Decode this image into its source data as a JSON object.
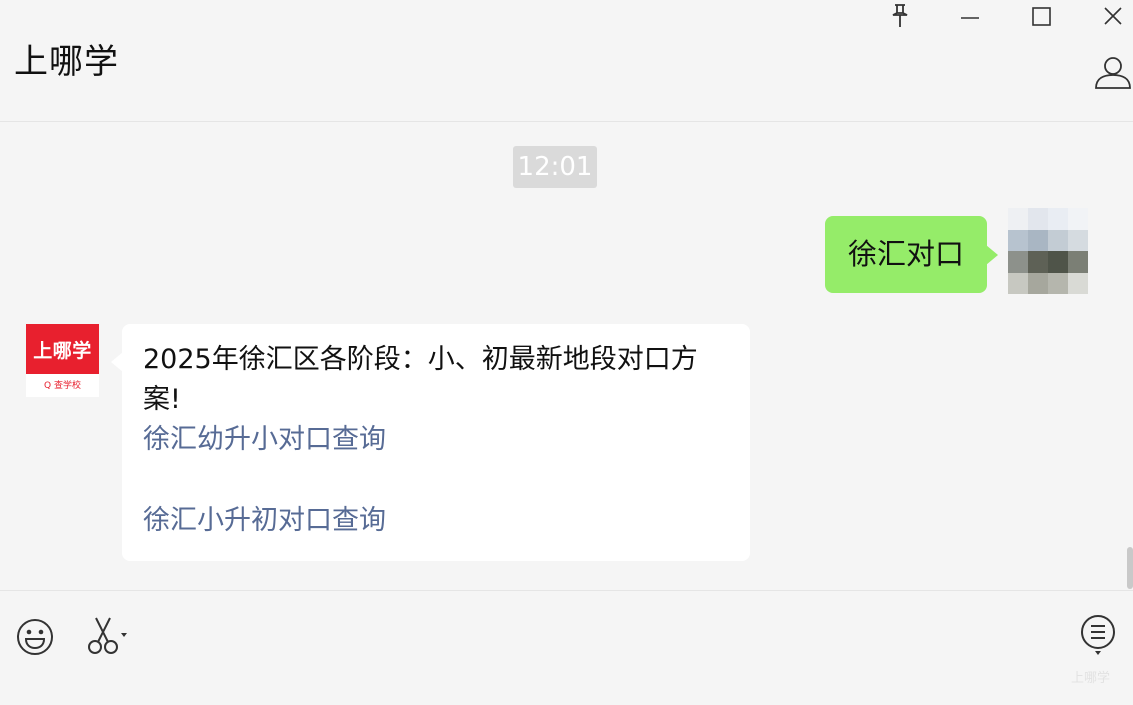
{
  "header": {
    "title": "上哪学"
  },
  "icons": {
    "pin": "pin-icon",
    "minimize": "minimize-icon",
    "maximize": "maximize-icon",
    "close": "close-icon",
    "user": "user-icon",
    "emoji": "emoji-icon",
    "scissors": "scissors-icon",
    "menu": "list-menu-icon"
  },
  "chat": {
    "timestamp": "12:01",
    "sent_message": "徐汇对口",
    "bot_avatar": {
      "brand": "上哪学",
      "tagline": "Q 查学校"
    },
    "received_message": {
      "text": "2025年徐汇区各阶段：小、初最新地段对口方案!",
      "links": [
        "徐汇幼升小对口查询",
        "徐汇小升初对口查询"
      ]
    }
  },
  "footer": {
    "watermark": "上哪学"
  },
  "colors": {
    "sent_bubble": "#95ec69",
    "link": "#576b95",
    "brand_red": "#e8202e",
    "background": "#f5f5f5"
  }
}
